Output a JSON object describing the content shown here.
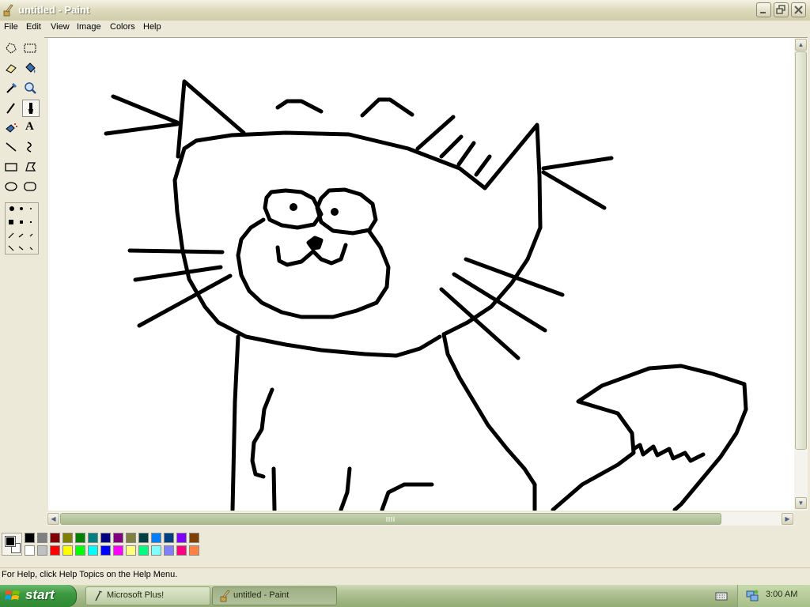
{
  "window": {
    "title": "untitled - Paint"
  },
  "menu": [
    "File",
    "Edit",
    "View",
    "Image",
    "Colors",
    "Help"
  ],
  "tools": [
    "free-form-select",
    "select",
    "eraser",
    "fill-with-color",
    "pick-color",
    "magnifier",
    "pencil",
    "brush",
    "airbrush",
    "text",
    "line",
    "curve",
    "rectangle",
    "polygon",
    "ellipse",
    "rounded-rectangle"
  ],
  "selected_tool": "brush",
  "text_tool_glyph": "A",
  "colors": {
    "foreground": "#000000",
    "background": "#ffffff",
    "palette_top": [
      "#000000",
      "#808080",
      "#800000",
      "#808000",
      "#008000",
      "#008080",
      "#000080",
      "#800080",
      "#808040",
      "#004040",
      "#0080ff",
      "#004080",
      "#8000ff",
      "#804000"
    ],
    "palette_bottom": [
      "#ffffff",
      "#c0c0c0",
      "#ff0000",
      "#ffff00",
      "#00ff00",
      "#00ffff",
      "#0000ff",
      "#ff00ff",
      "#ffff80",
      "#00ff80",
      "#80ffff",
      "#8080ff",
      "#ff0080",
      "#ff8040"
    ]
  },
  "status": {
    "text": "For Help, click Help Topics on the Help Menu."
  },
  "taskbar": {
    "start_label": "start",
    "buttons": [
      {
        "label": "Microsoft Plus!",
        "icon": "plus-icon",
        "active": false
      },
      {
        "label": "untitled - Paint",
        "icon": "paint-icon",
        "active": true
      }
    ],
    "clock": "3:00 AM"
  }
}
